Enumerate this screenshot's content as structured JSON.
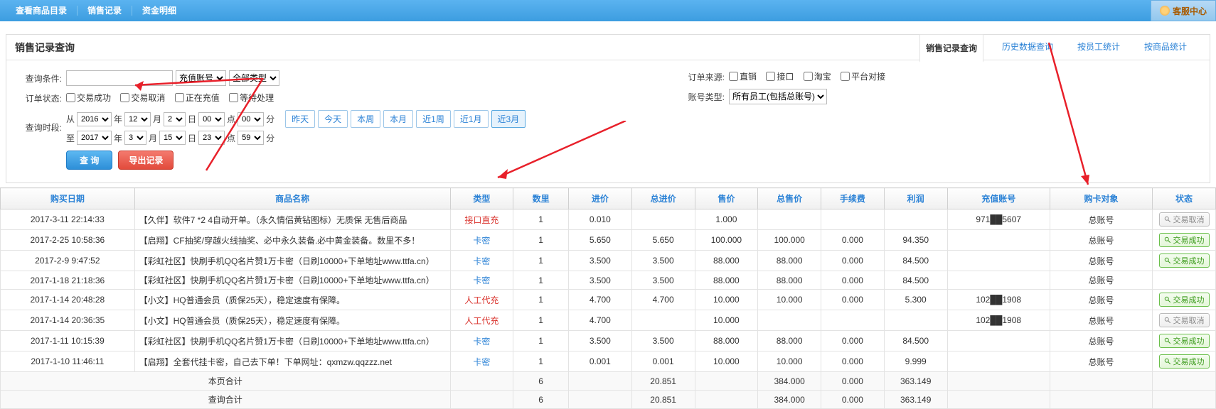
{
  "topnav": {
    "items": [
      "查看商品目录",
      "销售记录",
      "资金明细"
    ],
    "help_center": "客服中心"
  },
  "panel": {
    "title": "销售记录查询",
    "tabs": [
      "销售记录查询",
      "历史数据查询",
      "按员工统计",
      "按商品统计"
    ],
    "active_tab": 0
  },
  "filters": {
    "query_label": "查询条件:",
    "account_type_sel": "充值账号",
    "all_type_sel": "全部类型",
    "order_status_label": "订单状态:",
    "status_options": [
      "交易成功",
      "交易取消",
      "正在充值",
      "等待处理"
    ],
    "time_label": "查询时段:",
    "from_prefix": "从",
    "to_prefix": "至",
    "date_units": {
      "year": "年",
      "month": "月",
      "day": "日",
      "hour": "点",
      "min": "分"
    },
    "from": {
      "year": "2016",
      "month": "12",
      "day": "2",
      "hour": "00",
      "min": "00"
    },
    "to": {
      "year": "2017",
      "month": "3",
      "day": "15",
      "hour": "23",
      "min": "59"
    },
    "quick": [
      "昨天",
      "今天",
      "本周",
      "本月",
      "近1周",
      "近1月",
      "近3月"
    ],
    "quick_active": 6,
    "btn_query": "查 询",
    "btn_export": "导出记录",
    "source_label": "订单来源:",
    "source_options": [
      "直销",
      "接口",
      "淘宝",
      "平台对接"
    ],
    "account_cat_label": "账号类型:",
    "account_cat_sel": "所有员工(包括总账号)"
  },
  "table": {
    "widths": [
      170,
      400,
      80,
      70,
      80,
      80,
      80,
      80,
      80,
      80,
      130,
      130,
      80
    ],
    "headers": [
      "购买日期",
      "商品名称",
      "类型",
      "数里",
      "进价",
      "总进价",
      "售价",
      "总售价",
      "手续费",
      "利润",
      "充值账号",
      "购卡对象",
      "状态"
    ],
    "rows": [
      {
        "date": "2017-3-11 22:14:33",
        "name": "【久伴】软件7 *2 4自动开单。（永久情侣黄钻图标）无质保 无售后商品",
        "type": "接口直充",
        "type_cls": "type-red",
        "qty": "1",
        "price": "0.010",
        "total_price": "",
        "sale": "1.000",
        "total_sale": "",
        "fee": "",
        "profit": "",
        "account": "971██5607",
        "buyer": "总账号",
        "status": "交易取消",
        "status_cls": "status-cancel"
      },
      {
        "date": "2017-2-25 10:58:36",
        "name": "【启翔】CF抽奖/穿越火线抽奖、必中永久装备.必中黄金装备。数里不多！",
        "type": "卡密",
        "type_cls": "type-blue",
        "qty": "1",
        "price": "5.650",
        "total_price": "5.650",
        "sale": "100.000",
        "total_sale": "100.000",
        "fee": "0.000",
        "profit": "94.350",
        "account": "",
        "buyer": "总账号",
        "status": "交易成功",
        "status_cls": "status-success"
      },
      {
        "date": "2017-2-9 9:47:52",
        "name": "【彩虹社区】快刷手机QQ名片赞1万卡密（日刷10000+下单地址www.ttfa.cn）",
        "type": "卡密",
        "type_cls": "type-blue",
        "qty": "1",
        "price": "3.500",
        "total_price": "3.500",
        "sale": "88.000",
        "total_sale": "88.000",
        "fee": "0.000",
        "profit": "84.500",
        "account": "",
        "buyer": "总账号",
        "status": "交易成功",
        "status_cls": "status-success"
      },
      {
        "date": "2017-1-18 21:18:36",
        "name": "【彩虹社区】快刷手机QQ名片赞1万卡密（日刷10000+下单地址www.ttfa.cn）",
        "type": "卡密",
        "type_cls": "type-blue",
        "qty": "1",
        "price": "3.500",
        "total_price": "3.500",
        "sale": "88.000",
        "total_sale": "88.000",
        "fee": "0.000",
        "profit": "84.500",
        "account": "",
        "buyer": "总账号",
        "status": "",
        "status_cls": ""
      },
      {
        "date": "2017-1-14 20:48:28",
        "name": "【小文】HQ普通会员（质保25天），稳定速度有保障。",
        "type": "人工代充",
        "type_cls": "type-red",
        "qty": "1",
        "price": "4.700",
        "total_price": "4.700",
        "sale": "10.000",
        "total_sale": "10.000",
        "fee": "0.000",
        "profit": "5.300",
        "account": "102██1908",
        "buyer": "总账号",
        "status": "交易成功",
        "status_cls": "status-success"
      },
      {
        "date": "2017-1-14 20:36:35",
        "name": "【小文】HQ普通会员（质保25天），稳定速度有保障。",
        "type": "人工代充",
        "type_cls": "type-red",
        "qty": "1",
        "price": "4.700",
        "total_price": "",
        "sale": "10.000",
        "total_sale": "",
        "fee": "",
        "profit": "",
        "account": "102██1908",
        "buyer": "总账号",
        "status": "交易取消",
        "status_cls": "status-cancel"
      },
      {
        "date": "2017-1-11 10:15:39",
        "name": "【彩虹社区】快刷手机QQ名片赞1万卡密（日刷10000+下单地址www.ttfa.cn）",
        "type": "卡密",
        "type_cls": "type-blue",
        "qty": "1",
        "price": "3.500",
        "total_price": "3.500",
        "sale": "88.000",
        "total_sale": "88.000",
        "fee": "0.000",
        "profit": "84.500",
        "account": "",
        "buyer": "总账号",
        "status": "交易成功",
        "status_cls": "status-success"
      },
      {
        "date": "2017-1-10 11:46:11",
        "name": "【启翔】全套代挂卡密，自己去下单！下单网址：qxmzw.qqzzz.net",
        "type": "卡密",
        "type_cls": "type-blue",
        "qty": "1",
        "price": "0.001",
        "total_price": "0.001",
        "sale": "10.000",
        "total_sale": "10.000",
        "fee": "0.000",
        "profit": "9.999",
        "account": "",
        "buyer": "总账号",
        "status": "交易成功",
        "status_cls": "status-success"
      }
    ],
    "page_total": {
      "label": "本页合计",
      "qty": "6",
      "total_price": "20.851",
      "total_sale": "384.000",
      "fee": "0.000",
      "profit": "363.149"
    },
    "query_total": {
      "label": "查询合计",
      "qty": "6",
      "total_price": "20.851",
      "total_sale": "384.000",
      "fee": "0.000",
      "profit": "363.149"
    }
  }
}
